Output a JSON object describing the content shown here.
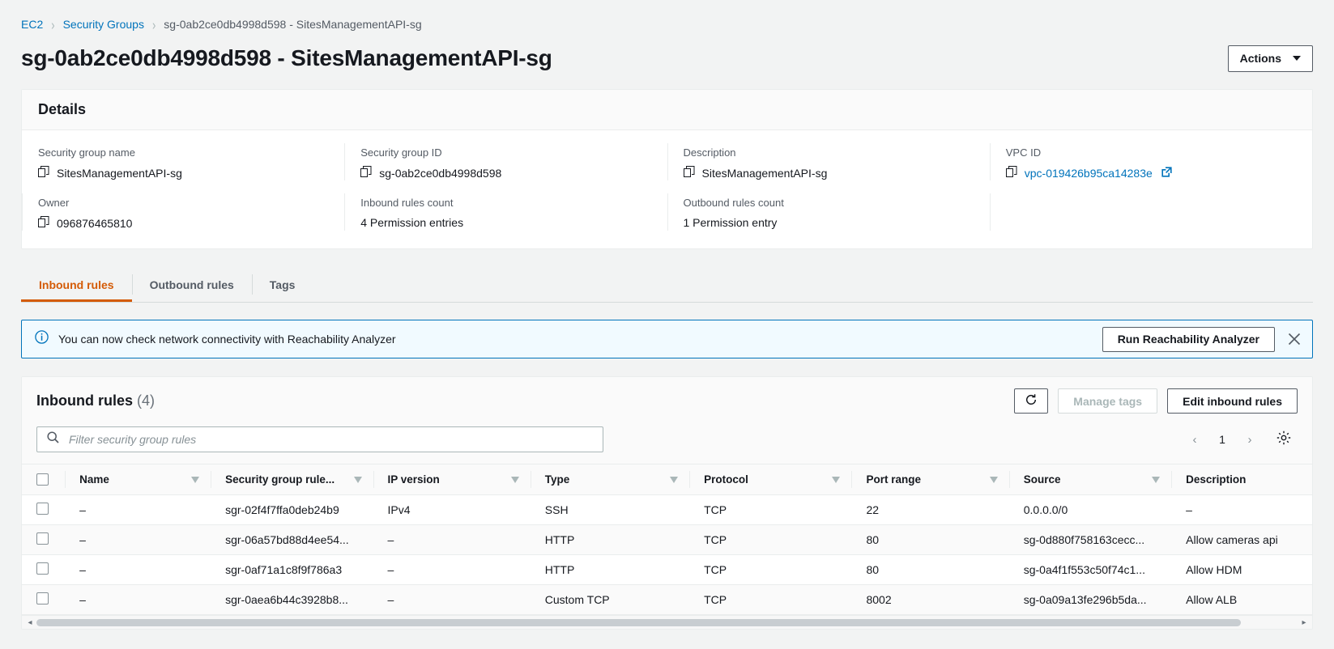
{
  "breadcrumb": {
    "items": [
      {
        "label": "EC2",
        "link": true
      },
      {
        "label": "Security Groups",
        "link": true
      },
      {
        "label": "sg-0ab2ce0db4998d598 - SitesManagementAPI-sg",
        "link": false
      }
    ],
    "separator": "›"
  },
  "header": {
    "title": "sg-0ab2ce0db4998d598 - SitesManagementAPI-sg",
    "actions_label": "Actions"
  },
  "details": {
    "heading": "Details",
    "fields": [
      {
        "label": "Security group name",
        "value": "SitesManagementAPI-sg",
        "copy": true,
        "link": false
      },
      {
        "label": "Security group ID",
        "value": "sg-0ab2ce0db4998d598",
        "copy": true,
        "link": false
      },
      {
        "label": "Description",
        "value": "SitesManagementAPI-sg",
        "copy": true,
        "link": false
      },
      {
        "label": "VPC ID",
        "value": "vpc-019426b95ca14283e",
        "copy": true,
        "link": true,
        "external": true
      },
      {
        "label": "Owner",
        "value": "096876465810",
        "copy": true,
        "link": false
      },
      {
        "label": "Inbound rules count",
        "value": "4 Permission entries",
        "copy": false,
        "link": false
      },
      {
        "label": "Outbound rules count",
        "value": "1 Permission entry",
        "copy": false,
        "link": false
      },
      {
        "label": "",
        "value": "",
        "copy": false,
        "link": false
      }
    ]
  },
  "tabs": [
    {
      "label": "Inbound rules",
      "active": true
    },
    {
      "label": "Outbound rules",
      "active": false
    },
    {
      "label": "Tags",
      "active": false
    }
  ],
  "banner": {
    "icon": "info-icon",
    "text": "You can now check network connectivity with Reachability Analyzer",
    "button_label": "Run Reachability Analyzer",
    "close_label": "×"
  },
  "table": {
    "title": "Inbound rules",
    "count": "(4)",
    "refresh_icon": "refresh-icon",
    "manage_tags_label": "Manage tags",
    "edit_label": "Edit inbound rules",
    "search_placeholder": "Filter security group rules",
    "search_value": "",
    "page_number": "1",
    "prev_arrow": "‹",
    "next_arrow": "›",
    "settings_icon": "gear-icon",
    "columns": [
      {
        "label": "Name",
        "sortable": true
      },
      {
        "label": "Security group rule...",
        "sortable": true
      },
      {
        "label": "IP version",
        "sortable": true
      },
      {
        "label": "Type",
        "sortable": true
      },
      {
        "label": "Protocol",
        "sortable": true
      },
      {
        "label": "Port range",
        "sortable": true
      },
      {
        "label": "Source",
        "sortable": true
      },
      {
        "label": "Description",
        "sortable": false
      }
    ],
    "rows": [
      {
        "name": "–",
        "rule_id": "sgr-02f4f7ffa0deb24b9",
        "ip_version": "IPv4",
        "type": "SSH",
        "protocol": "TCP",
        "port_range": "22",
        "source": "0.0.0.0/0",
        "description": "–"
      },
      {
        "name": "–",
        "rule_id": "sgr-06a57bd88d4ee54...",
        "ip_version": "–",
        "type": "HTTP",
        "protocol": "TCP",
        "port_range": "80",
        "source": "sg-0d880f758163cecc...",
        "description": "Allow cameras api"
      },
      {
        "name": "–",
        "rule_id": "sgr-0af71a1c8f9f786a3",
        "ip_version": "–",
        "type": "HTTP",
        "protocol": "TCP",
        "port_range": "80",
        "source": "sg-0a4f1f553c50f74c1...",
        "description": "Allow HDM"
      },
      {
        "name": "–",
        "rule_id": "sgr-0aea6b44c3928b8...",
        "ip_version": "–",
        "type": "Custom TCP",
        "protocol": "TCP",
        "port_range": "8002",
        "source": "sg-0a09a13fe296b5da...",
        "description": "Allow ALB"
      }
    ]
  },
  "colors": {
    "link": "#0073bb",
    "accent": "#d45b07",
    "page_bg": "#f2f3f3",
    "banner_bg": "#f1faff",
    "border": "#eaeded"
  }
}
